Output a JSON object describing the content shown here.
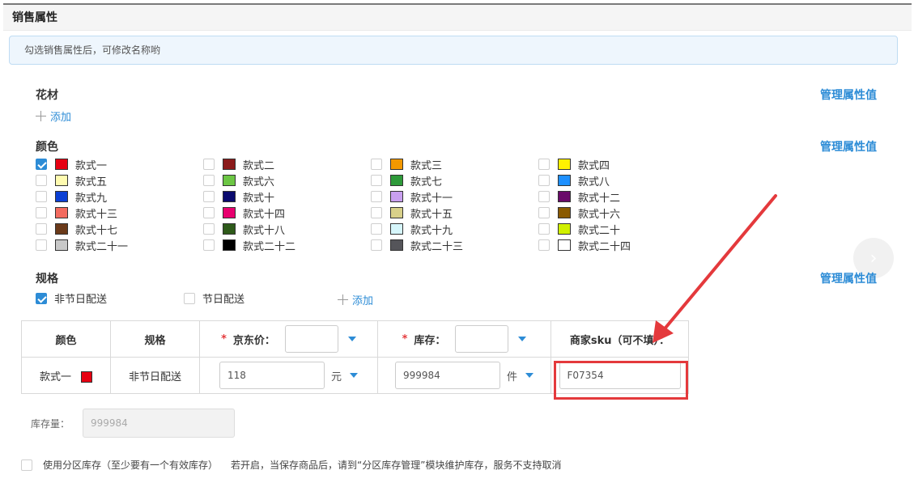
{
  "section": {
    "title": "销售属性",
    "hint": "勾选销售属性后，可修改名称哟"
  },
  "groups": {
    "material": {
      "title": "花材",
      "manage_label": "管理属性值",
      "add_label": "添加"
    },
    "color": {
      "title": "颜色",
      "manage_label": "管理属性值"
    },
    "spec": {
      "title": "规格",
      "manage_label": "管理属性值",
      "add_label": "添加"
    }
  },
  "colors": [
    {
      "label": "款式一",
      "color": "#e60012",
      "checked": true
    },
    {
      "label": "款式二",
      "color": "#8b1a1a",
      "checked": false
    },
    {
      "label": "款式三",
      "color": "#f39800",
      "checked": false
    },
    {
      "label": "款式四",
      "color": "#fff100",
      "checked": false
    },
    {
      "label": "款式五",
      "color": "#fffbb0",
      "checked": false
    },
    {
      "label": "款式六",
      "color": "#6cc644",
      "checked": false
    },
    {
      "label": "款式七",
      "color": "#2e9a3a",
      "checked": false
    },
    {
      "label": "款式八",
      "color": "#1e90ff",
      "checked": false
    },
    {
      "label": "款式九",
      "color": "#0b3fd4",
      "checked": false
    },
    {
      "label": "款式十",
      "color": "#0a0a6e",
      "checked": false
    },
    {
      "label": "款式十一",
      "color": "#c9a0f0",
      "checked": false
    },
    {
      "label": "款式十二",
      "color": "#6a0a6a",
      "checked": false
    },
    {
      "label": "款式十三",
      "color": "#f36b5f",
      "checked": false
    },
    {
      "label": "款式十四",
      "color": "#e8006f",
      "checked": false
    },
    {
      "label": "款式十五",
      "color": "#d8d08a",
      "checked": false
    },
    {
      "label": "款式十六",
      "color": "#8a5a00",
      "checked": false
    },
    {
      "label": "款式十七",
      "color": "#6b3a1a",
      "checked": false
    },
    {
      "label": "款式十八",
      "color": "#2e5a1a",
      "checked": false
    },
    {
      "label": "款式十九",
      "color": "#d6f6fb",
      "checked": false
    },
    {
      "label": "款式二十",
      "color": "#d0f000",
      "checked": false
    },
    {
      "label": "款式二十一",
      "color": "#c8c8c8",
      "checked": false
    },
    {
      "label": "款式二十二",
      "color": "#000000",
      "checked": false
    },
    {
      "label": "款式二十三",
      "color": "#55555a",
      "checked": false
    },
    {
      "label": "款式二十四",
      "color": "#ffffff",
      "checked": false
    }
  ],
  "specs": [
    {
      "label": "非节日配送",
      "checked": true
    },
    {
      "label": "节日配送",
      "checked": false
    }
  ],
  "sku_table": {
    "headers": {
      "color": "颜色",
      "spec": "规格",
      "price": "京东价：",
      "stock": "库存：",
      "sku": "商家sku（可不填）："
    },
    "required_mark": "*",
    "row": {
      "color": "款式一",
      "spec": "非节日配送",
      "price": "118",
      "price_unit": "元",
      "stock": "999984",
      "stock_unit": "件",
      "sku": "F07354"
    }
  },
  "stock_total": {
    "label": "库存量：",
    "value": "999984"
  },
  "zone_stock": {
    "label": "使用分区库存（至少要有一个有效库存）",
    "note": "若开启，当保存商品后，请到“分区库存管理”模块维护库存，服务不支持取消",
    "checked": false
  },
  "accent_color": "#2d8cd6",
  "highlight_color": "#e4393c"
}
